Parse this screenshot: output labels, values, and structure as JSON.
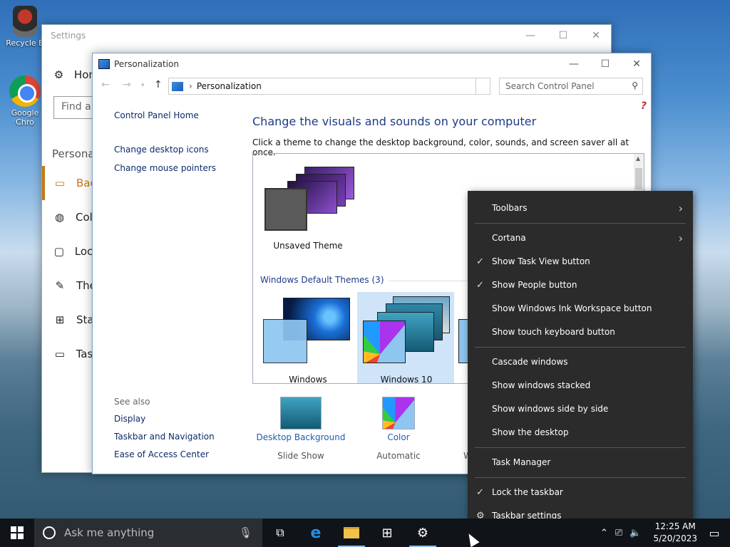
{
  "desktop": {
    "recycle_bin_label": "Recycle B",
    "chrome_label": "Google Chro"
  },
  "settings": {
    "title": "Settings",
    "home_label": "Hom",
    "find_placeholder": "Find a",
    "section": "Personal",
    "nav": [
      {
        "label": "Bac",
        "icon": "picture-icon"
      },
      {
        "label": "Colo",
        "icon": "palette-icon"
      },
      {
        "label": "Lock",
        "icon": "lock-screen-icon"
      },
      {
        "label": "The",
        "icon": "themes-icon"
      },
      {
        "label": "Star",
        "icon": "start-icon"
      },
      {
        "label": "Task",
        "icon": "taskbar-icon"
      }
    ],
    "controls": {
      "minimize": "—",
      "maximize": "☐",
      "close": "✕"
    }
  },
  "personalization": {
    "title": "Personalization",
    "address": "Personalization",
    "search_placeholder": "Search Control Panel",
    "help_glyph": "?",
    "left_links": [
      "Control Panel Home",
      "Change desktop icons",
      "Change mouse pointers"
    ],
    "see_also_header": "See also",
    "see_also": [
      "Display",
      "Taskbar and Navigation",
      "Ease of Access Center"
    ],
    "heading": "Change the visuals and sounds on your computer",
    "subheading": "Click a theme to change the desktop background, color, sounds, and screen saver all at once.",
    "themes": {
      "unsaved": "Unsaved Theme",
      "group_header": "Windows Default Themes (3)",
      "windows": "Windows",
      "windows10": "Windows 10"
    },
    "bottom": [
      {
        "link": "Desktop Background",
        "value": "Slide Show"
      },
      {
        "link": "Color",
        "value": "Automatic"
      }
    ],
    "cut_off_char": "W"
  },
  "context_menu": {
    "items": [
      {
        "label": "Toolbars",
        "check": false,
        "submenu": true
      },
      {
        "label": "Cortana",
        "check": false,
        "submenu": true
      },
      {
        "label": "Show Task View button",
        "check": true
      },
      {
        "label": "Show People button",
        "check": true
      },
      {
        "label": "Show Windows Ink Workspace button",
        "check": false
      },
      {
        "label": "Show touch keyboard button",
        "check": false
      },
      {
        "label": "Cascade windows",
        "check": false
      },
      {
        "label": "Show windows stacked",
        "check": false
      },
      {
        "label": "Show windows side by side",
        "check": false
      },
      {
        "label": "Show the desktop",
        "check": false
      },
      {
        "label": "Task Manager",
        "check": false
      },
      {
        "label": "Lock the taskbar",
        "check": true
      },
      {
        "label": "Taskbar settings",
        "check": false
      }
    ]
  },
  "taskbar": {
    "search_placeholder": "Ask me anything",
    "time": "12:25 AM",
    "date": "5/20/2023"
  }
}
